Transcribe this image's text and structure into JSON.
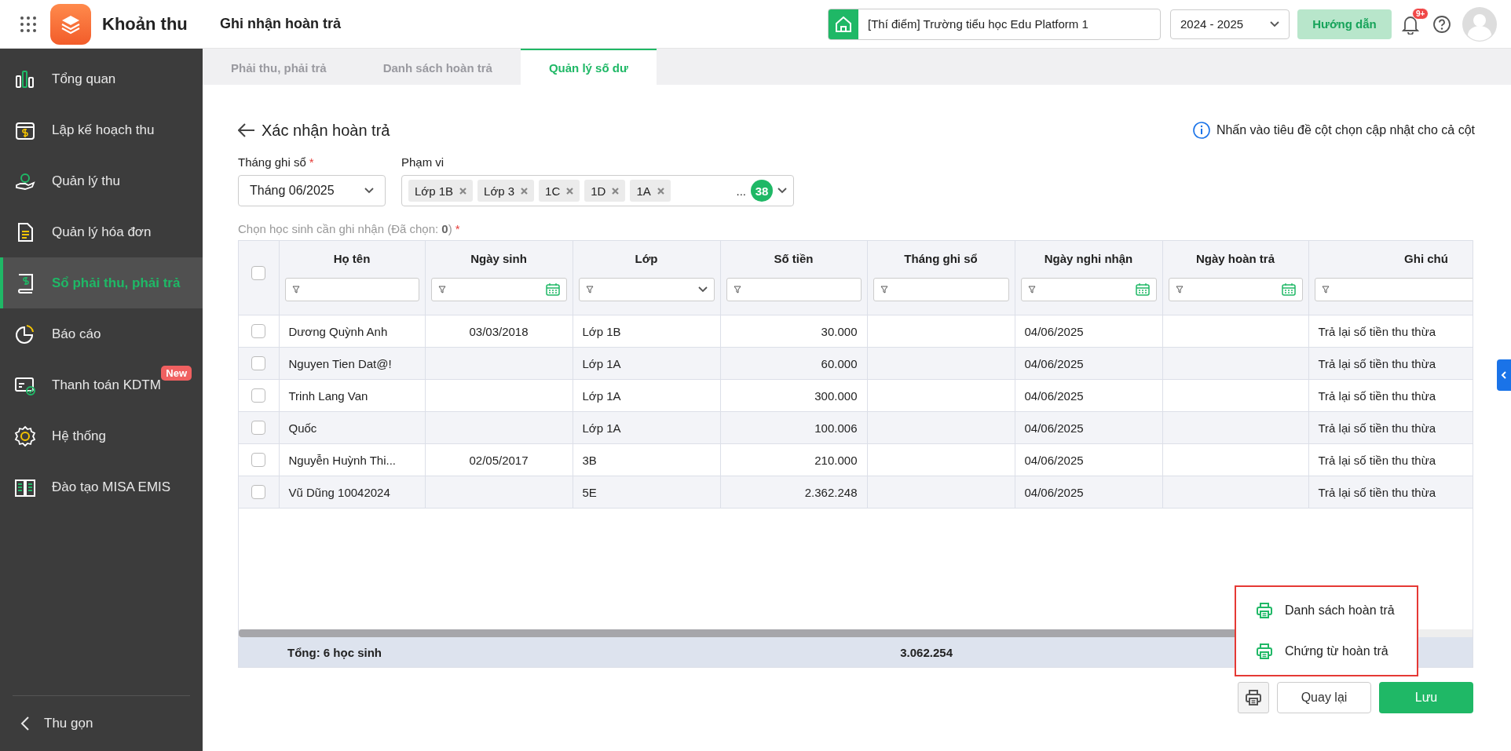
{
  "app": {
    "title": "Khoản thu"
  },
  "header": {
    "page_title": "Ghi nhận hoàn trả",
    "school": "[Thí điểm] Trường tiểu học Edu Platform 1",
    "year": "2024 - 2025",
    "help_button": "Hướng dẫn",
    "notification_count": "9+"
  },
  "sidebar": {
    "items": [
      {
        "label": "Tổng quan",
        "selected": false
      },
      {
        "label": "Lập kế hoạch thu",
        "selected": false
      },
      {
        "label": "Quản lý thu",
        "selected": false
      },
      {
        "label": "Quản lý hóa đơn",
        "selected": false
      },
      {
        "label": "Sổ phải thu, phải trả",
        "selected": true
      },
      {
        "label": "Báo cáo",
        "selected": false
      },
      {
        "label": "Thanh toán KDTM",
        "selected": false,
        "badge": "New"
      },
      {
        "label": "Hệ thống",
        "selected": false
      },
      {
        "label": "Đào tạo MISA EMIS",
        "selected": false
      }
    ],
    "collapse": "Thu gọn"
  },
  "tabs": [
    {
      "label": "Phải thu, phải trả",
      "selected": false
    },
    {
      "label": "Danh sách hoàn trả",
      "selected": false
    },
    {
      "label": "Quản lý số dư",
      "selected": true
    }
  ],
  "form": {
    "title": "Xác nhận hoàn trả",
    "hint": "Nhấn vào tiêu đề cột chọn cập nhật cho cả cột",
    "month": {
      "label": "Tháng ghi sổ",
      "required_mark": "*",
      "value": "Tháng 06/2025"
    },
    "scope": {
      "label": "Phạm vi",
      "tags": [
        "Lớp 1B",
        "Lớp 3",
        "1C",
        "1D",
        "1A"
      ],
      "more": "...",
      "count": "38"
    },
    "selection_label": "Chọn học sinh cần ghi nhận (Đã chọn: **0**)",
    "selection_required_mark": "*"
  },
  "table": {
    "select_all_checked": false,
    "columns": [
      {
        "label": "Họ tên",
        "kind": "text"
      },
      {
        "label": "Ngày sinh",
        "kind": "date"
      },
      {
        "label": "Lớp",
        "kind": "select"
      },
      {
        "label": "Số tiền",
        "kind": "text"
      },
      {
        "label": "Tháng ghi sổ",
        "kind": "text"
      },
      {
        "label": "Ngày nghi nhận",
        "kind": "date"
      },
      {
        "label": "Ngày hoàn trả",
        "kind": "date"
      },
      {
        "label": "Ghi chú",
        "kind": "text"
      }
    ],
    "rows": [
      {
        "checked": false,
        "cells": [
          "Dương Quỳnh Anh",
          "03/03/2018",
          "Lớp 1B",
          "30.000",
          "",
          "04/06/2025",
          "",
          "Trả lại số tiền thu thừa"
        ]
      },
      {
        "checked": false,
        "cells": [
          "Nguyen Tien Dat@!",
          "",
          "Lớp 1A",
          "60.000",
          "",
          "04/06/2025",
          "",
          "Trả lại số tiền thu thừa"
        ]
      },
      {
        "checked": false,
        "cells": [
          "Trinh Lang Van",
          "",
          "Lớp 1A",
          "300.000",
          "",
          "04/06/2025",
          "",
          "Trả lại số tiền thu thừa"
        ]
      },
      {
        "checked": false,
        "cells": [
          "Quốc",
          "",
          "Lớp 1A",
          "100.006",
          "",
          "04/06/2025",
          "",
          "Trả lại số tiền thu thừa"
        ]
      },
      {
        "checked": false,
        "cells": [
          "Nguyễn Huỳnh Thi...",
          "02/05/2017",
          "3B",
          "210.000",
          "",
          "04/06/2025",
          "",
          "Trả lại số tiền thu thừa"
        ]
      },
      {
        "checked": false,
        "cells": [
          "Vũ Dũng 10042024",
          "",
          "5E",
          "2.362.248",
          "",
          "04/06/2025",
          "",
          "Trả lại số tiền thu thừa"
        ]
      }
    ],
    "total": {
      "label": "Tổng: 6 học sinh",
      "amount": "3.062.254"
    }
  },
  "print_menu": [
    "Danh sách hoàn trả",
    "Chứng từ hoàn trả"
  ],
  "buttons": {
    "back": "Quay lại",
    "save": "Lưu"
  }
}
